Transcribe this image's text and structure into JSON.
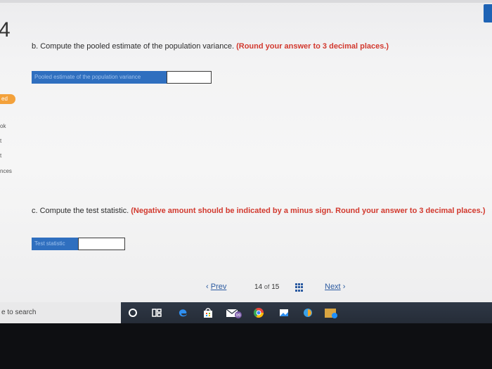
{
  "header": {
    "question_number": "4"
  },
  "sidebar": {
    "fragments": [
      "ed",
      "ok",
      "t",
      "t",
      "nces"
    ]
  },
  "part_b": {
    "prompt": "b. Compute the pooled estimate of the population variance.",
    "note": "(Round your answer to 3 decimal places.)",
    "answer_label": "Pooled estimate of the population variance",
    "answer_value": ""
  },
  "part_c": {
    "prompt": "c. Compute the test statistic.",
    "note": "(Negative amount should be indicated by a minus sign. Round your answer to 3 decimal places.)",
    "answer_label": "Test statistic",
    "answer_value": ""
  },
  "navigation": {
    "prev_label": "Prev",
    "next_label": "Next",
    "current_page": "14",
    "of_label": "of",
    "total_pages": "15"
  },
  "taskbar": {
    "search_text": "e to search",
    "badge_count": "99"
  },
  "colors": {
    "accent_blue": "#2f6fbf",
    "note_red": "#d2392e",
    "link_blue": "#2b5aa0",
    "sidebar_orange": "#f3a13b"
  },
  "icons": [
    "chevron-left-icon",
    "chevron-right-icon",
    "grid-icon",
    "cortana-icon",
    "task-view-icon",
    "edge-icon",
    "store-icon",
    "mail-icon",
    "chrome-icon",
    "photos-icon"
  ]
}
